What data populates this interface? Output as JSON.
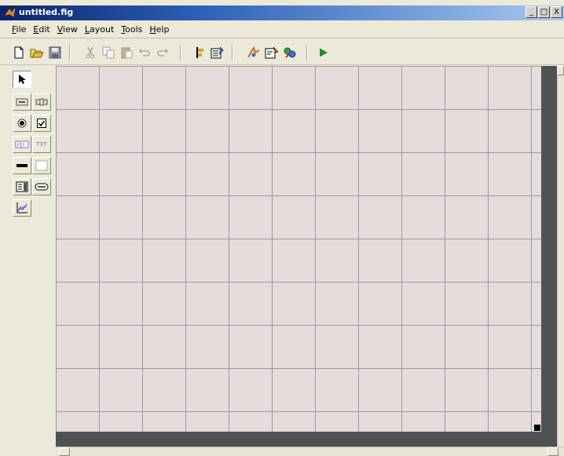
{
  "window": {
    "title": "untitled.fig",
    "controls": {
      "minimize": "_",
      "maximize": "□",
      "close": "X"
    }
  },
  "menu": [
    {
      "label": "File"
    },
    {
      "label": "Edit"
    },
    {
      "label": "View"
    },
    {
      "label": "Layout"
    },
    {
      "label": "Tools"
    },
    {
      "label": "Help"
    }
  ],
  "toolbar": {
    "buttons": [
      "new-icon",
      "open-icon",
      "save-icon",
      "cut-icon",
      "copy-icon",
      "paste-icon",
      "undo-icon",
      "redo-icon",
      "align-icon",
      "menu-editor-icon",
      "tab-order-icon",
      "m-file-editor-icon",
      "property-inspector-icon",
      "object-browser-icon",
      "run-icon"
    ]
  },
  "palette": {
    "tools": [
      "select",
      "push-button",
      "slider",
      "radio-button",
      "check-box",
      "edit-text",
      "static-text",
      "popup-menu",
      "listbox",
      "toggle-button",
      "table",
      "axes"
    ],
    "static_text_glyph": "TXT"
  },
  "colors": {
    "canvas": "#e7dcdc",
    "grid": "#9a9a9a",
    "frame": "#4e5252",
    "titlebar": "#0a246a",
    "run_arrow": "#1f8f2a"
  }
}
